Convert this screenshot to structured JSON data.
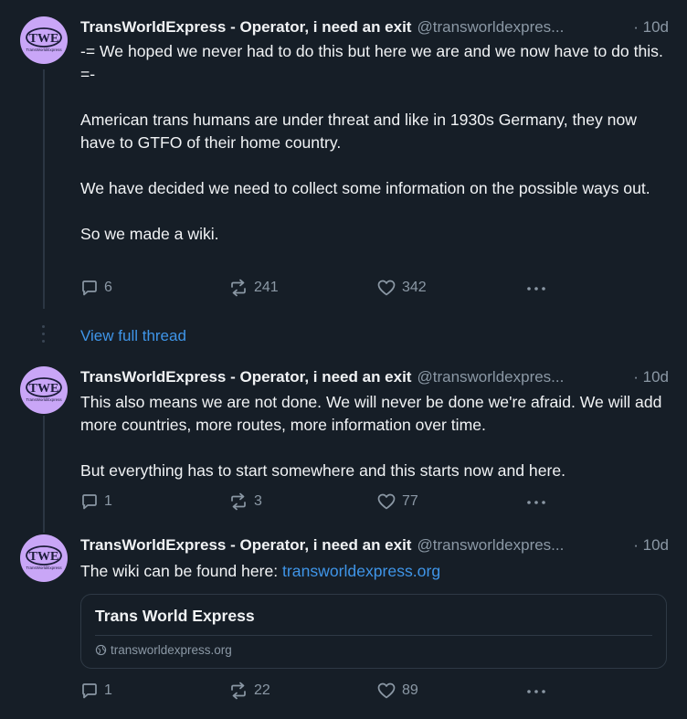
{
  "posts": [
    {
      "display_name": "TransWorldExpress - Operator, i need an exit",
      "handle": "@transworldexpres...",
      "time": "· 10d",
      "avatar_text": "TWE",
      "avatar_subtext": "TransWorldExpress",
      "body": "-= We hoped we never had to do this but here we are and we now have to do this. =-\n\nAmerican trans humans are under threat and like in 1930s Germany, they now have to GTFO of their home country.\n\nWe have decided we need to collect some information on the possible ways out.\n\nSo we made a wiki.",
      "replies": "6",
      "reposts": "241",
      "likes": "342"
    },
    {
      "display_name": "TransWorldExpress - Operator, i need an exit",
      "handle": "@transworldexpres...",
      "time": "· 10d",
      "avatar_text": "TWE",
      "avatar_subtext": "TransWorldExpress",
      "body": "This also means we are not done. We will never be done we're afraid. We will add more countries, more routes, more information over time.\n\nBut everything has to start somewhere and this starts now and here.",
      "replies": "1",
      "reposts": "3",
      "likes": "77"
    },
    {
      "display_name": "TransWorldExpress - Operator, i need an exit",
      "handle": "@transworldexpres...",
      "time": "· 10d",
      "avatar_text": "TWE",
      "avatar_subtext": "TransWorldExpress",
      "body_prefix": "The wiki can be found here: ",
      "body_link": "transworldexpress.org",
      "replies": "1",
      "reposts": "22",
      "likes": "89"
    }
  ],
  "view_full_thread": "View full thread",
  "link_card": {
    "title": "Trans World Express",
    "url": "transworldexpress.org"
  },
  "icons": {
    "reply": "reply-icon",
    "repost": "repost-icon",
    "like": "heart-icon",
    "more": "more-icon",
    "globe": "globe-icon"
  },
  "colors": {
    "background": "#161e27",
    "text": "#f1f3f5",
    "muted": "#8b98a5",
    "link": "#3f95e8",
    "avatar": "#c9a6f7"
  }
}
